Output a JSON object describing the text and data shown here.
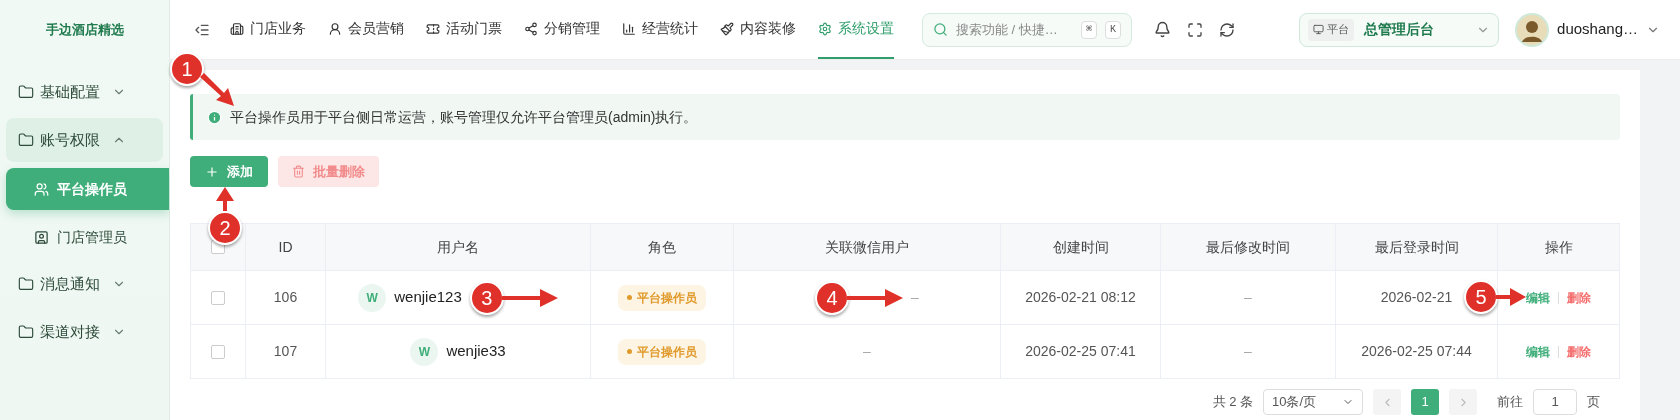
{
  "brand": "手边酒店精选",
  "sidebar": {
    "items": [
      {
        "label": "基础配置",
        "expanded": false
      },
      {
        "label": "账号权限",
        "expanded": true,
        "children": [
          {
            "label": "平台操作员",
            "selected": true
          },
          {
            "label": "门店管理员",
            "selected": false
          }
        ]
      },
      {
        "label": "消息通知",
        "expanded": false
      },
      {
        "label": "渠道对接",
        "expanded": false
      }
    ]
  },
  "nav": {
    "tabs": [
      {
        "label": "门店业务",
        "selected": false
      },
      {
        "label": "会员营销",
        "selected": false
      },
      {
        "label": "活动门票",
        "selected": false
      },
      {
        "label": "分销管理",
        "selected": false
      },
      {
        "label": "经营统计",
        "selected": false
      },
      {
        "label": "内容装修",
        "selected": false
      },
      {
        "label": "系统设置",
        "selected": true
      }
    ]
  },
  "search": {
    "placeholder": "搜索功能 / 快捷…",
    "keys": [
      "⌘",
      "K"
    ]
  },
  "scope": {
    "tag": "平台",
    "name": "总管理后台"
  },
  "user": {
    "name": "duoshang…"
  },
  "alert": {
    "text": "平台操作员用于平台侧日常运营，账号管理仅允许平台管理员(admin)执行。",
    "callout": "1"
  },
  "actions": {
    "add": {
      "label": "添加",
      "callout": "2"
    },
    "batch_delete": {
      "label": "批量删除",
      "disabled": true
    }
  },
  "table": {
    "header_checked": false,
    "columns": [
      "ID",
      "用户名",
      "角色",
      "关联微信用户",
      "创建时间",
      "最后修改时间",
      "最后登录时间",
      "操作"
    ],
    "rows": [
      {
        "checked": false,
        "id": "106",
        "avatar": "W",
        "username": "wenjie123",
        "role": "平台操作员",
        "wechat": "–",
        "created": "2026-02-21 08:12",
        "modified": "–",
        "last_login": "2026-02-21",
        "edit": "编辑",
        "delete": "删除",
        "callouts": {
          "username": "3",
          "wechat": "4",
          "last_login": "5"
        }
      },
      {
        "checked": false,
        "id": "107",
        "avatar": "W",
        "username": "wenjie33",
        "role": "平台操作员",
        "wechat": "–",
        "created": "2026-02-25 07:41",
        "modified": "–",
        "last_login": "2026-02-25 07:44",
        "edit": "编辑",
        "delete": "删除"
      }
    ]
  },
  "pagination": {
    "total": "共 2 条",
    "page_size": "10条/页",
    "pages": [
      {
        "label": "1",
        "selected": true
      }
    ],
    "goto_label": "前往",
    "goto_value": "1",
    "goto_suffix": "页"
  }
}
